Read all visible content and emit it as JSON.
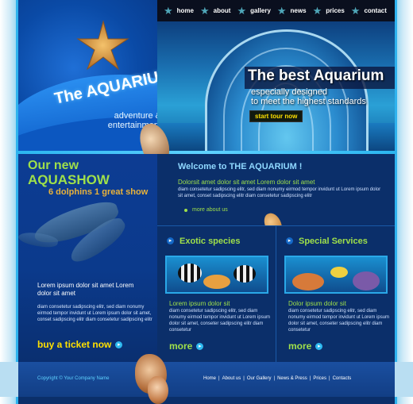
{
  "nav": {
    "items": [
      {
        "label": "home"
      },
      {
        "label": "about"
      },
      {
        "label": "gallery"
      },
      {
        "label": "news"
      },
      {
        "label": "prices"
      },
      {
        "label": "contact"
      }
    ]
  },
  "logo": {
    "title": "The AQUARIUM",
    "tagline_1": "adventure &",
    "tagline_2": "entertainment"
  },
  "hero": {
    "title": "The best Aquarium",
    "sub_1": "especially designed",
    "sub_2": "to meet the highest standards",
    "button": "start tour now"
  },
  "promo": {
    "heading_1": "Our new",
    "heading_2": "AQUASHOW",
    "heading_3": "6 dolphins 1 great show",
    "lead": "Lorem ipsum dolor sit amet Lorem dolor sit amet",
    "body": "diam consetetur sadipscing elitr, sed diam nonumy eirmod tempor invidunt ut Lorem ipsum dolor sit amet, conset sadipscing elitr diam consetetur sadipscing elitr",
    "ticket": "buy a ticket now"
  },
  "welcome": {
    "title": "Welcome to THE AQUARIUM !",
    "lead": "Dolorsit amet dolor sit amet Lorem dolor sit amet",
    "body": "diam consetetur sadipscing elitr, sed diam nonumy eirmod tempor invidunt ut Lorem ipsum dolor sit amet, conset sadipscing elitr diam consetetur sadipscing elitr",
    "more_link": "more about us"
  },
  "columns": [
    {
      "title": "Exotic species",
      "lead": "Lorem ipsum dolor sit",
      "body": "diam consetetur sadipscing elitr, sed diam nonumy eirmod tempor invidunt ut Lorem ipsum dolor sit amet, conseter sadipscing elitr diam consetetur",
      "more": "more"
    },
    {
      "title": "Special Services",
      "lead": "Dolor ipsum dolor sit",
      "body": "diam consetetur sadipscing elitr, sed diam nonumy eirmod tempor invidunt ut Lorem ipsum dolor sit amet, conseter sadipscing elitr diam consetetur",
      "more": "more"
    }
  ],
  "footer": {
    "copyright": "Copyright © Your Company Name",
    "links": [
      "Home",
      "About us",
      "Our Gallery",
      "News & Press",
      "Prices",
      "Contacts"
    ],
    "separator": "|"
  },
  "icons": {
    "nav_star": "★",
    "arrow": "▸"
  },
  "colors": {
    "frame_blue": "#0a3a86",
    "accent_cyan": "#2fb3ee",
    "lime": "#9fe04a",
    "yellow": "#ffe000",
    "orange": "#e8b23a"
  }
}
